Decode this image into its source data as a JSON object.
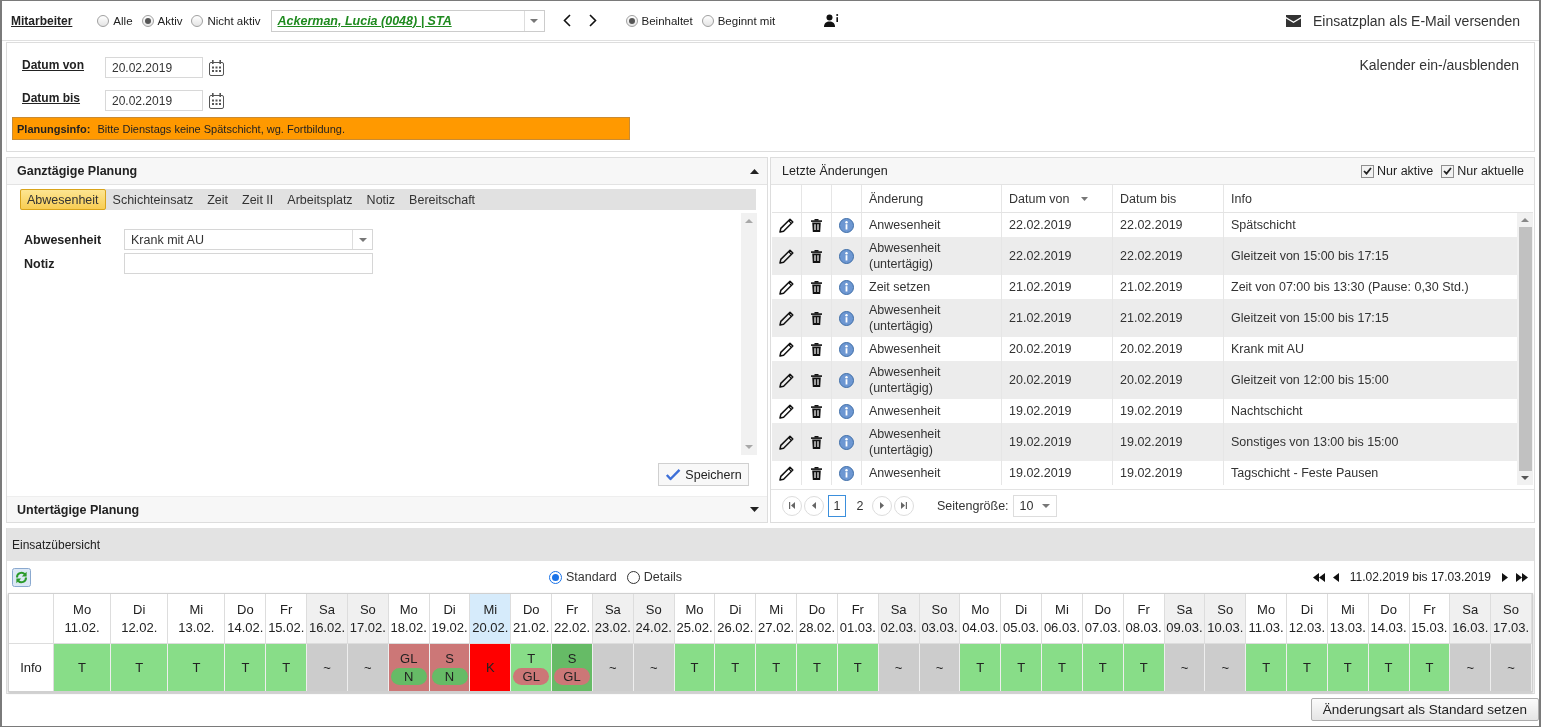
{
  "topbar": {
    "label": "Mitarbeiter",
    "status_filter": [
      {
        "label": "Alle",
        "selected": false
      },
      {
        "label": "Aktiv",
        "selected": true
      },
      {
        "label": "Nicht aktiv",
        "selected": false
      }
    ],
    "employee": {
      "value": "Ackerman, Lucia (0048) | STA"
    },
    "match_mode": [
      {
        "label": "Beinhaltet",
        "selected": true
      },
      {
        "label": "Beginnt mit",
        "selected": false
      }
    ],
    "email_action": "Einsatzplan als E-Mail versenden"
  },
  "dates": {
    "fields": [
      {
        "label": "Datum von",
        "value": "20.02.2019"
      },
      {
        "label": "Datum bis",
        "value": "20.02.2019"
      }
    ],
    "planning_info": {
      "label": "Planungsinfo:",
      "text": "Bitte Dienstags keine Spätschicht, wg. Fortbildung."
    },
    "calendar_toggle": "Kalender ein-/ausblenden"
  },
  "full_day_planning": {
    "title": "Ganztägige Planung",
    "expanded": true,
    "tabs": [
      {
        "label": "Abwesenheit",
        "selected": true
      },
      {
        "label": "Schichteinsatz",
        "selected": false
      },
      {
        "label": "Zeit",
        "selected": false
      },
      {
        "label": "Zeit II",
        "selected": false
      },
      {
        "label": "Arbeitsplatz",
        "selected": false
      },
      {
        "label": "Notiz",
        "selected": false
      },
      {
        "label": "Bereitschaft",
        "selected": false
      }
    ],
    "form": [
      {
        "label": "Abwesenheit",
        "kind": "select",
        "value": "Krank mit AU"
      },
      {
        "label": "Notiz",
        "kind": "text"
      }
    ],
    "save_button": "Speichern"
  },
  "intraday_planning": {
    "title": "Untertägige Planung",
    "expanded": false
  },
  "recent_changes": {
    "title": "Letzte Änderungen",
    "filters": [
      {
        "label": "Nur aktive",
        "checked": true
      },
      {
        "label": "Nur aktuelle",
        "checked": true
      }
    ],
    "columns": [
      {
        "label": "Änderung",
        "sorted": false
      },
      {
        "label": "Datum von",
        "sorted": true
      },
      {
        "label": "Datum bis",
        "sorted": false
      },
      {
        "label": "Info",
        "sorted": false
      }
    ],
    "rows": [
      {
        "cells": [
          "Anwesenheit",
          "22.02.2019",
          "22.02.2019",
          "Spätschicht"
        ]
      },
      {
        "cells": [
          "Abwesenheit (untertägig)",
          "22.02.2019",
          "22.02.2019",
          "Gleitzeit von 15:00 bis 17:15"
        ]
      },
      {
        "cells": [
          "Zeit setzen",
          "21.02.2019",
          "21.02.2019",
          "Zeit von 07:00 bis 13:30 (Pause: 0,30 Std.)"
        ]
      },
      {
        "cells": [
          "Abwesenheit (untertägig)",
          "21.02.2019",
          "21.02.2019",
          "Gleitzeit von 15:00 bis 17:15"
        ]
      },
      {
        "cells": [
          "Abwesenheit",
          "20.02.2019",
          "20.02.2019",
          "Krank mit AU"
        ]
      },
      {
        "cells": [
          "Abwesenheit (untertägig)",
          "20.02.2019",
          "20.02.2019",
          "Gleitzeit von 12:00 bis 15:00"
        ]
      },
      {
        "cells": [
          "Anwesenheit",
          "19.02.2019",
          "19.02.2019",
          "Nachtschicht"
        ]
      },
      {
        "cells": [
          "Abwesenheit (untertägig)",
          "19.02.2019",
          "19.02.2019",
          "Sonstiges von 13:00 bis 15:00"
        ]
      },
      {
        "cells": [
          "Anwesenheit",
          "19.02.2019",
          "19.02.2019",
          "Tagschicht - Feste Pausen"
        ]
      }
    ],
    "pager": {
      "pages": [
        {
          "label": "1",
          "selected": true
        },
        {
          "label": "2",
          "selected": false
        }
      ],
      "page_size_label": "Seitengröße:",
      "page_size": "10"
    }
  },
  "overview": {
    "title": "Einsatzübersicht",
    "views": [
      {
        "label": "Standard",
        "selected": true
      },
      {
        "label": "Details",
        "selected": false
      }
    ],
    "range": "11.02.2019 bis 17.03.2019",
    "row_label": "Info",
    "days": [
      {
        "weekday": "Mo",
        "date": "11.02.",
        "weekend": false,
        "selected": false,
        "entries": [
          {
            "code": "T",
            "color": "#88dd88"
          }
        ]
      },
      {
        "weekday": "Di",
        "date": "12.02.",
        "weekend": false,
        "selected": false,
        "entries": [
          {
            "code": "T",
            "color": "#88dd88"
          }
        ]
      },
      {
        "weekday": "Mi",
        "date": "13.02.",
        "weekend": false,
        "selected": false,
        "entries": [
          {
            "code": "T",
            "color": "#88dd88"
          }
        ]
      },
      {
        "weekday": "Do",
        "date": "14.02.",
        "weekend": false,
        "selected": false,
        "entries": [
          {
            "code": "T",
            "color": "#88dd88"
          }
        ]
      },
      {
        "weekday": "Fr",
        "date": "15.02.",
        "weekend": false,
        "selected": false,
        "entries": [
          {
            "code": "T",
            "color": "#88dd88"
          }
        ]
      },
      {
        "weekday": "Sa",
        "date": "16.02.",
        "weekend": true,
        "selected": false,
        "entries": [
          {
            "code": "~",
            "color": "#cccccc"
          }
        ]
      },
      {
        "weekday": "So",
        "date": "17.02.",
        "weekend": true,
        "selected": false,
        "entries": [
          {
            "code": "~",
            "color": "#cccccc"
          }
        ]
      },
      {
        "weekday": "Mo",
        "date": "18.02.",
        "weekend": false,
        "selected": false,
        "entries": [
          {
            "code": "GL",
            "color": "#cc7777"
          },
          {
            "code": "N",
            "color": "#66bb66"
          }
        ]
      },
      {
        "weekday": "Di",
        "date": "19.02.",
        "weekend": false,
        "selected": false,
        "entries": [
          {
            "code": "S",
            "color": "#cc7777"
          },
          {
            "code": "N",
            "color": "#66bb66"
          }
        ]
      },
      {
        "weekday": "Mi",
        "date": "20.02.",
        "weekend": false,
        "selected": true,
        "entries": [
          {
            "code": "K",
            "color": "#ff0000"
          }
        ]
      },
      {
        "weekday": "Do",
        "date": "21.02.",
        "weekend": false,
        "selected": false,
        "entries": [
          {
            "code": "T",
            "color": "#88dd88"
          },
          {
            "code": "GL",
            "color": "#cc7777"
          }
        ]
      },
      {
        "weekday": "Fr",
        "date": "22.02.",
        "weekend": false,
        "selected": false,
        "entries": [
          {
            "code": "S",
            "color": "#66bb66"
          },
          {
            "code": "GL",
            "color": "#cc7777"
          }
        ]
      },
      {
        "weekday": "Sa",
        "date": "23.02.",
        "weekend": true,
        "selected": false,
        "entries": [
          {
            "code": "~",
            "color": "#cccccc"
          }
        ]
      },
      {
        "weekday": "So",
        "date": "24.02.",
        "weekend": true,
        "selected": false,
        "entries": [
          {
            "code": "~",
            "color": "#cccccc"
          }
        ]
      },
      {
        "weekday": "Mo",
        "date": "25.02.",
        "weekend": false,
        "selected": false,
        "entries": [
          {
            "code": "T",
            "color": "#88dd88"
          }
        ]
      },
      {
        "weekday": "Di",
        "date": "26.02.",
        "weekend": false,
        "selected": false,
        "entries": [
          {
            "code": "T",
            "color": "#88dd88"
          }
        ]
      },
      {
        "weekday": "Mi",
        "date": "27.02.",
        "weekend": false,
        "selected": false,
        "entries": [
          {
            "code": "T",
            "color": "#88dd88"
          }
        ]
      },
      {
        "weekday": "Do",
        "date": "28.02.",
        "weekend": false,
        "selected": false,
        "entries": [
          {
            "code": "T",
            "color": "#88dd88"
          }
        ]
      },
      {
        "weekday": "Fr",
        "date": "01.03.",
        "weekend": false,
        "selected": false,
        "entries": [
          {
            "code": "T",
            "color": "#88dd88"
          }
        ]
      },
      {
        "weekday": "Sa",
        "date": "02.03.",
        "weekend": true,
        "selected": false,
        "entries": [
          {
            "code": "~",
            "color": "#cccccc"
          }
        ]
      },
      {
        "weekday": "So",
        "date": "03.03.",
        "weekend": true,
        "selected": false,
        "entries": [
          {
            "code": "~",
            "color": "#cccccc"
          }
        ]
      },
      {
        "weekday": "Mo",
        "date": "04.03.",
        "weekend": false,
        "selected": false,
        "entries": [
          {
            "code": "T",
            "color": "#88dd88"
          }
        ]
      },
      {
        "weekday": "Di",
        "date": "05.03.",
        "weekend": false,
        "selected": false,
        "entries": [
          {
            "code": "T",
            "color": "#88dd88"
          }
        ]
      },
      {
        "weekday": "Mi",
        "date": "06.03.",
        "weekend": false,
        "selected": false,
        "entries": [
          {
            "code": "T",
            "color": "#88dd88"
          }
        ]
      },
      {
        "weekday": "Do",
        "date": "07.03.",
        "weekend": false,
        "selected": false,
        "entries": [
          {
            "code": "T",
            "color": "#88dd88"
          }
        ]
      },
      {
        "weekday": "Fr",
        "date": "08.03.",
        "weekend": false,
        "selected": false,
        "entries": [
          {
            "code": "T",
            "color": "#88dd88"
          }
        ]
      },
      {
        "weekday": "Sa",
        "date": "09.03.",
        "weekend": true,
        "selected": false,
        "entries": [
          {
            "code": "~",
            "color": "#cccccc"
          }
        ]
      },
      {
        "weekday": "So",
        "date": "10.03.",
        "weekend": true,
        "selected": false,
        "entries": [
          {
            "code": "~",
            "color": "#cccccc"
          }
        ]
      },
      {
        "weekday": "Mo",
        "date": "11.03.",
        "weekend": false,
        "selected": false,
        "entries": [
          {
            "code": "T",
            "color": "#88dd88"
          }
        ]
      },
      {
        "weekday": "Di",
        "date": "12.03.",
        "weekend": false,
        "selected": false,
        "entries": [
          {
            "code": "T",
            "color": "#88dd88"
          }
        ]
      },
      {
        "weekday": "Mi",
        "date": "13.03.",
        "weekend": false,
        "selected": false,
        "entries": [
          {
            "code": "T",
            "color": "#88dd88"
          }
        ]
      },
      {
        "weekday": "Do",
        "date": "14.03.",
        "weekend": false,
        "selected": false,
        "entries": [
          {
            "code": "T",
            "color": "#88dd88"
          }
        ]
      },
      {
        "weekday": "Fr",
        "date": "15.03.",
        "weekend": false,
        "selected": false,
        "entries": [
          {
            "code": "T",
            "color": "#88dd88"
          }
        ]
      },
      {
        "weekday": "Sa",
        "date": "16.03.",
        "weekend": true,
        "selected": false,
        "entries": [
          {
            "code": "~",
            "color": "#cccccc"
          }
        ]
      },
      {
        "weekday": "So",
        "date": "17.03.",
        "weekend": true,
        "selected": false,
        "entries": [
          {
            "code": "~",
            "color": "#cccccc"
          }
        ]
      }
    ]
  },
  "footer_button": "Änderungsart als Standard setzen"
}
